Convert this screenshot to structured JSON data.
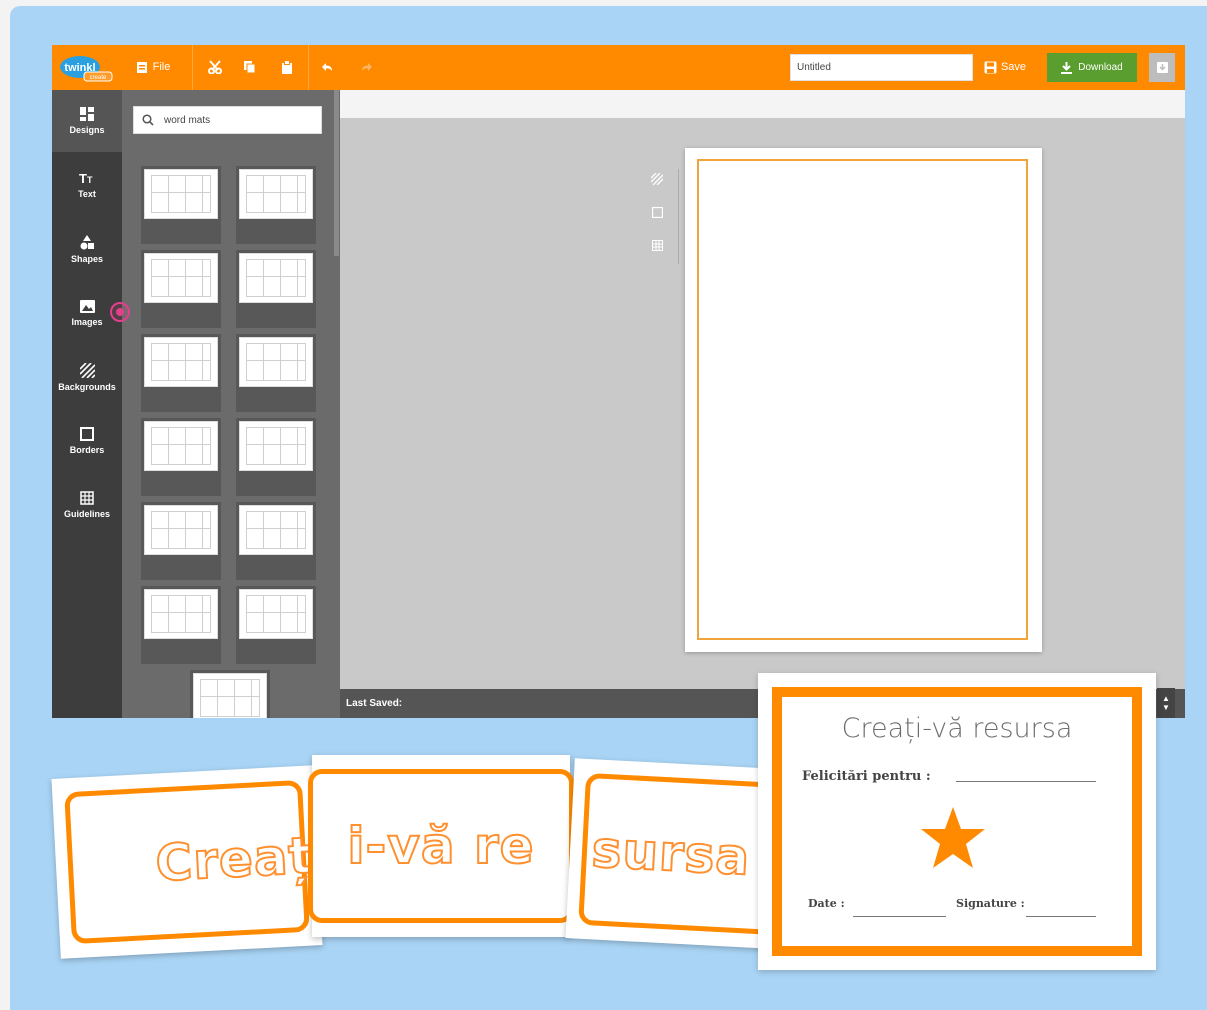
{
  "app": {
    "logo_text": "twinkl",
    "logo_sub": "create",
    "toolbar": {
      "file_label": "File",
      "title_value": "Untitled",
      "save_label": "Save",
      "download_label": "Download"
    },
    "rail": [
      {
        "label": "Designs",
        "icon": "grid-icon"
      },
      {
        "label": "Text",
        "icon": "text-icon"
      },
      {
        "label": "Shapes",
        "icon": "shapes-icon"
      },
      {
        "label": "Images",
        "icon": "image-icon"
      },
      {
        "label": "Backgrounds",
        "icon": "backgrounds-icon"
      },
      {
        "label": "Borders",
        "icon": "border-icon"
      },
      {
        "label": "Guidelines",
        "icon": "guidelines-icon"
      }
    ],
    "search": {
      "value": "word mats"
    },
    "status": {
      "last_saved": "Last Saved:"
    }
  },
  "promo": {
    "cards": [
      "Creaț",
      "i-vă  re",
      "sursa"
    ],
    "certificate": {
      "title": "Creați-vă resursa",
      "line1": "Felicitări pentru :",
      "line2_left": "Date :",
      "line2_right": "Signature :"
    }
  },
  "colors": {
    "brand_orange": "#ff8a00",
    "download_green": "#5a9e2f",
    "background_blue": "#a9d4f5"
  }
}
